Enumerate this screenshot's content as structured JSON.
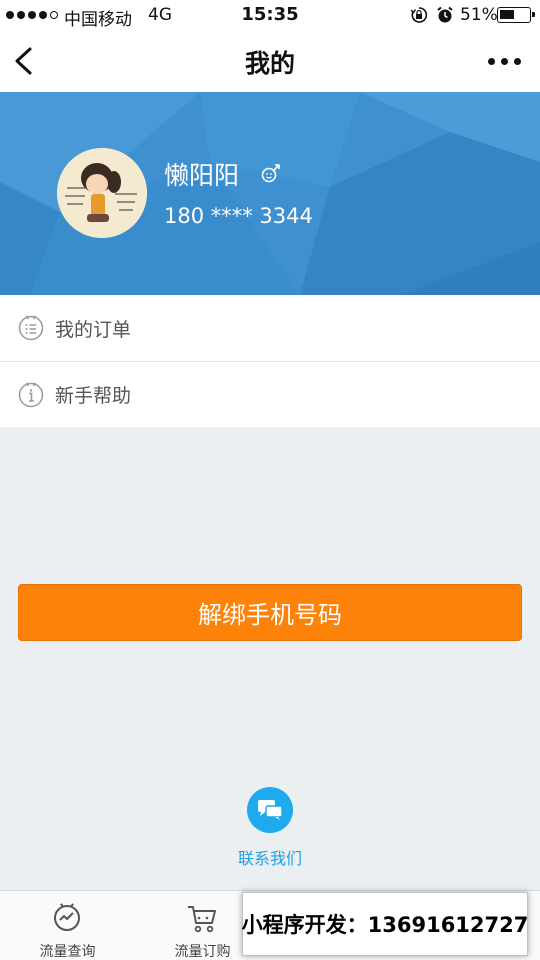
{
  "status_bar": {
    "carrier": "中国移动",
    "network": "4G",
    "time": "15:35",
    "battery": "51%"
  },
  "nav": {
    "title": "我的"
  },
  "profile": {
    "name": "懒阳阳",
    "phone": "180 **** 3344",
    "header_color": "#3d8fd0"
  },
  "menu": [
    {
      "label": "我的订单",
      "icon": "list-icon"
    },
    {
      "label": "新手帮助",
      "icon": "info-icon"
    }
  ],
  "unbind_button": {
    "label": "解绑手机号码",
    "color": "#fd8209"
  },
  "contact": {
    "label": "联系我们",
    "icon": "chat-bubbles-icon",
    "color": "#1fa9ee"
  },
  "tabs": [
    {
      "label": "流量查询",
      "icon": "gauge-icon"
    },
    {
      "label": "流量订购",
      "icon": "cart-icon"
    }
  ],
  "promo": {
    "text": "小程序开发：13691612727"
  }
}
